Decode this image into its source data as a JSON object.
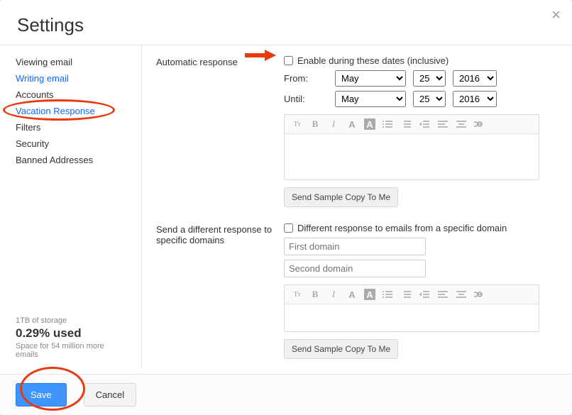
{
  "header": {
    "title": "Settings"
  },
  "sidebar": {
    "items": [
      {
        "label": "Viewing email"
      },
      {
        "label": "Writing email"
      },
      {
        "label": "Accounts"
      },
      {
        "label": "Vacation Response"
      },
      {
        "label": "Filters"
      },
      {
        "label": "Security"
      },
      {
        "label": "Banned Addresses"
      }
    ],
    "storage": {
      "line1": "1TB of storage",
      "pct": "0.29% used",
      "line2": "Space for 54 million more emails"
    }
  },
  "sections": {
    "auto": {
      "label": "Automatic response",
      "enable": "Enable during these dates (inclusive)",
      "from": "From:",
      "until": "Until:",
      "month": "May",
      "day": "25",
      "year": "2016",
      "sample": "Send Sample Copy To Me"
    },
    "domain": {
      "label": "Send a different response to specific domains",
      "diff": "Different response to emails from a specific domain",
      "first": "First domain",
      "second": "Second domain",
      "sample": "Send Sample Copy To Me"
    }
  },
  "toolbar_glyphs": {
    "tt": "Tᴛ",
    "b": "B",
    "i": "I",
    "a": "A",
    "abox": "A"
  },
  "footer": {
    "save": "Save",
    "cancel": "Cancel"
  }
}
